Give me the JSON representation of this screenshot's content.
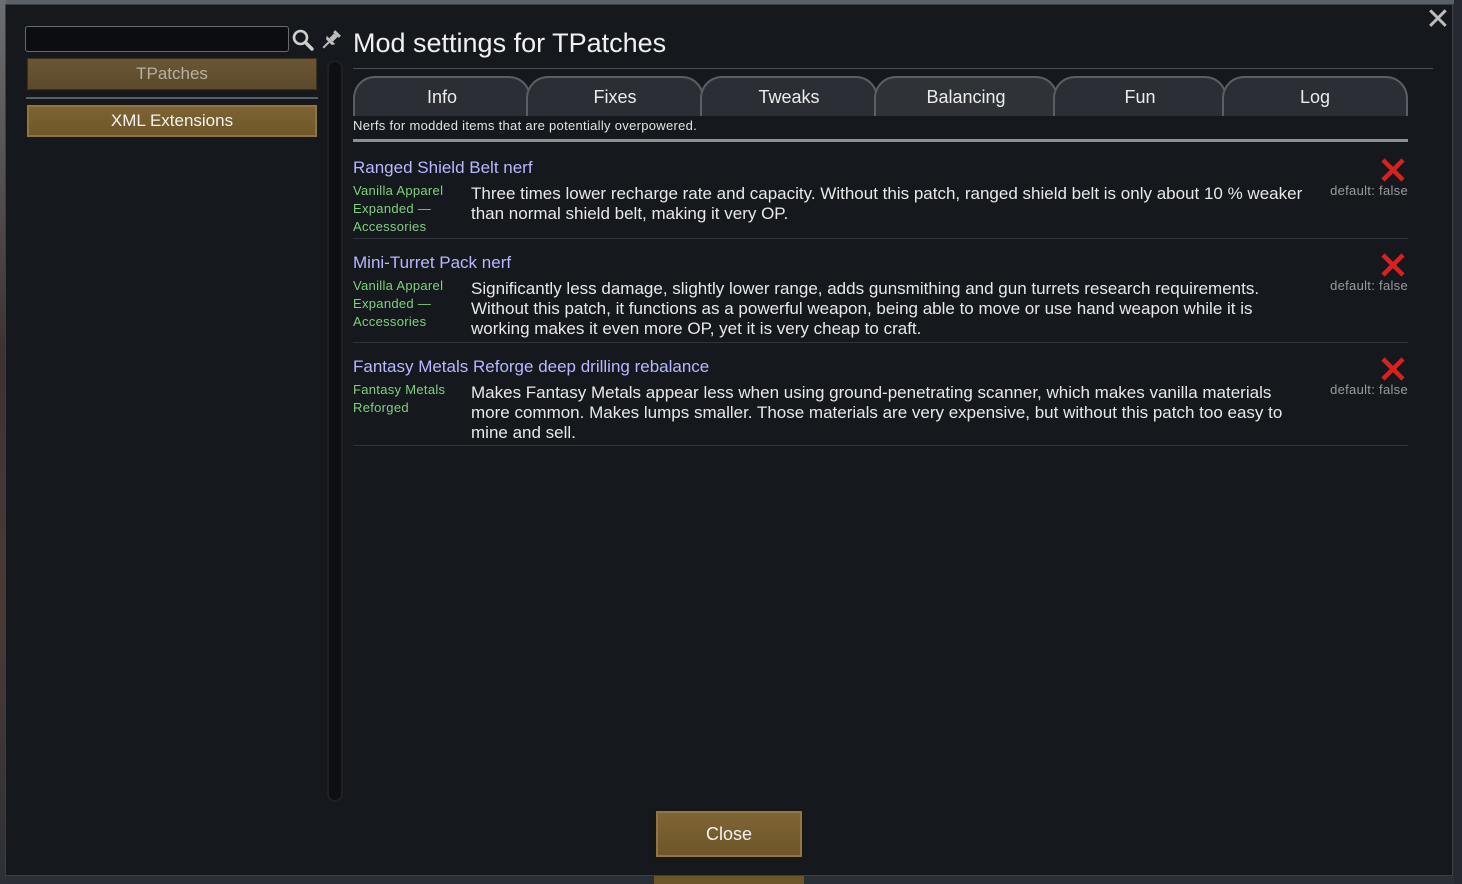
{
  "window": {
    "title": "Mod settings for TPatches",
    "close_glyph": "✕"
  },
  "sidebar": {
    "search_value": "",
    "mods": [
      {
        "label": "TPatches",
        "selected": true
      },
      {
        "label": "XML Extensions",
        "selected": false
      }
    ]
  },
  "tabs": [
    {
      "label": "Info"
    },
    {
      "label": "Fixes"
    },
    {
      "label": "Tweaks"
    },
    {
      "label": "Balancing",
      "active": true
    },
    {
      "label": "Fun"
    },
    {
      "label": "Log"
    }
  ],
  "tab_description": "Nerfs for modded items that are potentially overpowered.",
  "settings": [
    {
      "title": "Ranged Shield Belt nerf",
      "mod": "Vanilla Apparel Expanded — Accessories",
      "description": "Three times lower recharge rate and capacity. Without this patch, ranged shield belt is only about 10 % weaker than normal shield belt, making it very OP.",
      "value": false,
      "default_label": "default: false"
    },
    {
      "title": "Mini-Turret Pack nerf",
      "mod": "Vanilla Apparel Expanded — Accessories",
      "description": "Significantly less damage, slightly lower range, adds gunsmithing and gun turrets research requirements. Without this patch, it functions as a powerful weapon, being able to move or use hand weapon while it is working makes it even more OP, yet it is very cheap to craft.",
      "value": false,
      "default_label": "default: false"
    },
    {
      "title": "Fantasy Metals Reforge deep drilling rebalance",
      "mod": "Fantasy Metals Reforged",
      "description": "Makes Fantasy Metals appear less when using ground-penetrating scanner, which makes vanilla materials more common. Makes lumps smaller. Those materials are very expensive, but without this patch too easy to mine and sell.",
      "value": false,
      "default_label": "default: false"
    }
  ],
  "footer": {
    "close_label": "Close"
  },
  "colors": {
    "title_link": "#b7b8ff",
    "mod_name": "#7fd17f",
    "toggle_off": "#d9211f",
    "button_gold": "#7f6434"
  },
  "icons": {
    "search": "search-icon",
    "pin": "pin-icon",
    "toggle": "cross-icon",
    "close": "close-icon"
  }
}
